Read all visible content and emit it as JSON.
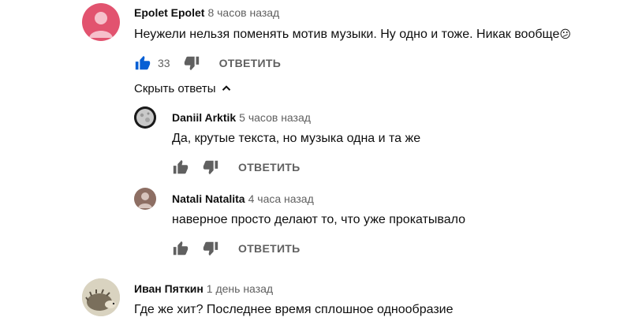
{
  "comments": [
    {
      "author": "Epolet Epolet",
      "time": "8 часов назад",
      "text": "Неужели нельзя поменять мотив музыки. Ну одно и тоже. Никак вообще",
      "emoji": "😕",
      "likes": "33",
      "reply_label": "ОТВЕТИТЬ",
      "like_color": "#065fd4"
    }
  ],
  "toggle_replies": "Скрыть ответы",
  "replies": [
    {
      "author": "Daniil Arktik",
      "time": "5 часов назад",
      "text": "Да, крутые текста, но музыка одна и та же",
      "reply_label": "ОТВЕТИТЬ"
    },
    {
      "author": "Natali Natalita",
      "time": "4 часа назад",
      "text": "наверное просто делают то, что уже прокатывало",
      "reply_label": "ОТВЕТИТЬ"
    }
  ],
  "comment3": {
    "author": "Иван Пяткин",
    "time": "1 день назад",
    "text": "Где же хит? Последнее время сплошное однообразие"
  },
  "colors": {
    "accent": "#065fd4",
    "avatar_pink": "#e2536f",
    "avatar_brown": "#8d6e63",
    "secondary_text": "#606060"
  }
}
